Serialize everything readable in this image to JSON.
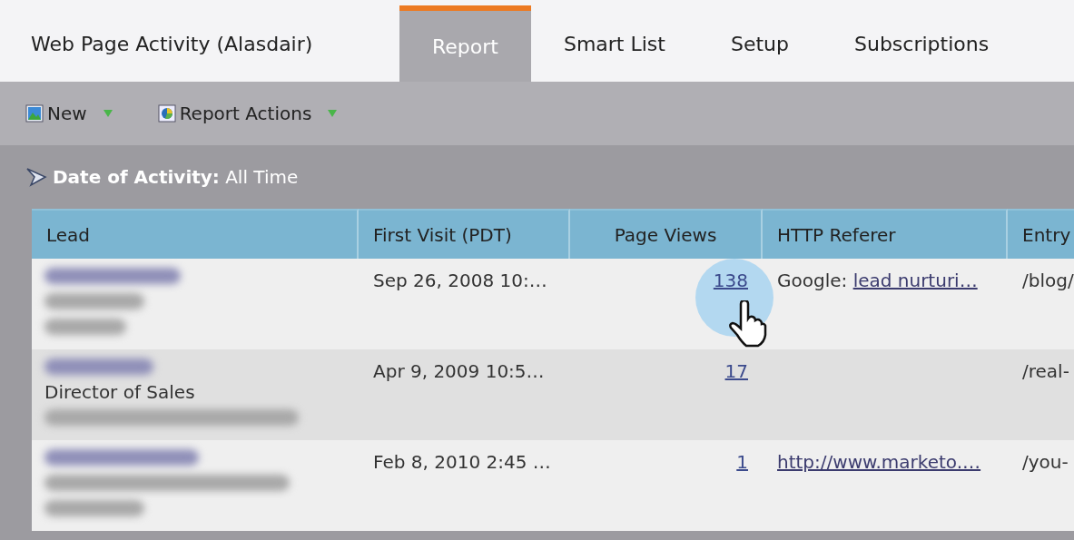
{
  "title": "Web Page Activity (Alasdair)",
  "tabs": [
    {
      "label": "Report",
      "selected": true
    },
    {
      "label": "Smart List",
      "selected": false
    },
    {
      "label": "Setup",
      "selected": false
    },
    {
      "label": "Subscriptions",
      "selected": false
    }
  ],
  "toolbar": [
    {
      "label": "New",
      "kind": "new"
    },
    {
      "label": "Report Actions",
      "kind": "report"
    }
  ],
  "filter": {
    "label": "Date of Activity:",
    "value": "All Time"
  },
  "table": {
    "columns": [
      "Lead",
      "First Visit (PDT)",
      "Page Views",
      "HTTP Referer",
      "Entry"
    ],
    "rows": [
      {
        "lead": [
          {
            "kind": "blurred-link"
          },
          {
            "kind": "blurred"
          },
          {
            "kind": "blurred"
          }
        ],
        "first_visit": "Sep 26, 2008 10:…",
        "page_views": "138",
        "hovered": true,
        "referer": [
          {
            "kind": "text",
            "text": "Google: "
          },
          {
            "kind": "link",
            "text": "lead nurturi…"
          }
        ],
        "entry": "/blog/"
      },
      {
        "lead": [
          {
            "kind": "blurred-link"
          },
          {
            "kind": "text",
            "text": "Director of Sales"
          },
          {
            "kind": "blurred"
          }
        ],
        "first_visit": "Apr 9, 2009 10:5…",
        "page_views": "17",
        "hovered": false,
        "referer": [],
        "entry": "/real-"
      },
      {
        "lead": [
          {
            "kind": "blurred-link"
          },
          {
            "kind": "blurred"
          },
          {
            "kind": "blurred"
          }
        ],
        "first_visit": "Feb 8, 2010 2:45 …",
        "page_views": "1",
        "hovered": false,
        "referer": [
          {
            "kind": "link",
            "text": "http://www.marketo.…"
          }
        ],
        "entry": "/you-"
      }
    ]
  }
}
